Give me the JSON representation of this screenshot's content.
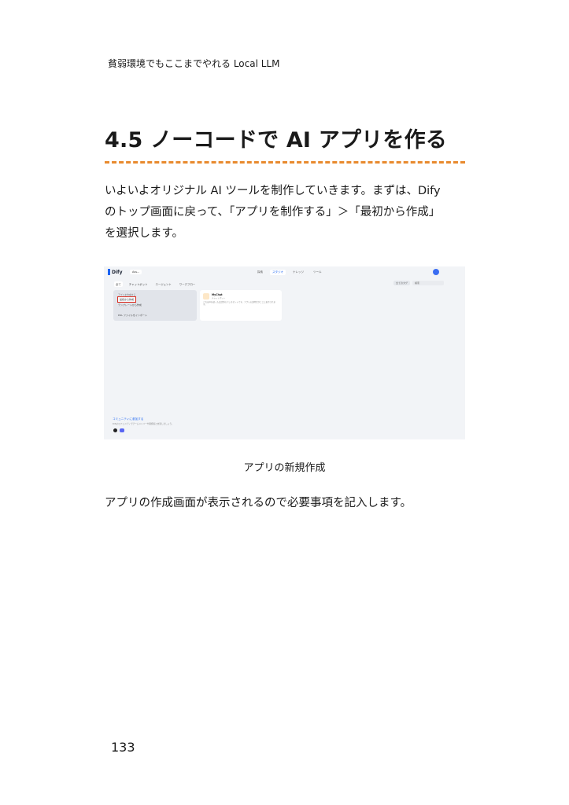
{
  "running_header": "貧弱環境でもここまでやれる Local LLM",
  "section_title": "4.5 ノーコードで AI アプリを作る",
  "intro_lines": [
    "いよいよオリジナル AI ツールを制作していきます。まずは、Dify",
    "のトップ画面に戻って、「アプリを制作する」＞「最初から作成」",
    "を選択します。"
  ],
  "figure": {
    "logo": "Dify",
    "workspace": "Ass...",
    "nav": [
      "探索",
      "スタジオ",
      "ナレッジ",
      "ツール"
    ],
    "tabs": [
      "全て",
      "チャットボット",
      "エージェント",
      "ワークフロー"
    ],
    "filters": [
      "全てのタグ",
      "検索"
    ],
    "create_card": {
      "heading": "アプリを作成する",
      "option_blank": "最初から作成",
      "option_template": "テンプレートから作成",
      "option_import": "DSL ファイルをインポート"
    },
    "app_card": {
      "name": "MyChat",
      "type": "チャットボット",
      "description": "これはAIを使った会話型のアシスタントです。アプリの説明文がここに表示されます。"
    },
    "community_link": "コミュニティに参加する",
    "community_text": "Difyのコミュニティでチームメンバーや開発者と交流しましょう。"
  },
  "caption": "アプリの新規作成",
  "after_text": "アプリの作成画面が表示されるので必要事項を記入します。",
  "page_number": "133",
  "colors": {
    "accent_rule": "#e88a2e",
    "dify_blue": "#1c64f2",
    "highlight_red": "#d92d20"
  }
}
